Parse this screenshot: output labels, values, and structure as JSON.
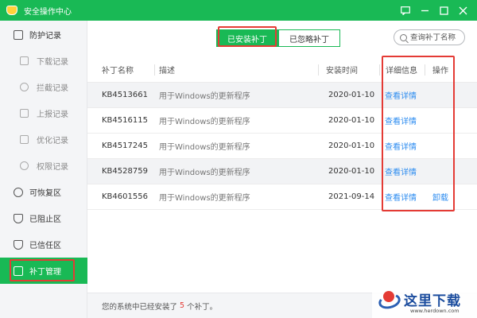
{
  "window": {
    "title": "安全操作中心",
    "controls": [
      "message-icon",
      "minimize-icon",
      "maximize-icon",
      "close-icon"
    ]
  },
  "sidebar": {
    "items": [
      {
        "label": "防护记录",
        "icon": "shield-record-icon",
        "type": "group"
      },
      {
        "label": "下载记录",
        "icon": "download-icon",
        "type": "sub"
      },
      {
        "label": "拦截记录",
        "icon": "block-icon",
        "type": "sub"
      },
      {
        "label": "上报记录",
        "icon": "upload-icon",
        "type": "sub"
      },
      {
        "label": "优化记录",
        "icon": "document-icon",
        "type": "sub"
      },
      {
        "label": "权限记录",
        "icon": "key-icon",
        "type": "sub"
      },
      {
        "label": "可恢复区",
        "icon": "restore-icon",
        "type": "group"
      },
      {
        "label": "已阻止区",
        "icon": "blocked-shield-icon",
        "type": "group"
      },
      {
        "label": "已信任区",
        "icon": "trusted-shield-icon",
        "type": "group"
      },
      {
        "label": "补丁管理",
        "icon": "grid-icon",
        "type": "group",
        "active": true
      }
    ]
  },
  "tabs": [
    {
      "label": "已安装补丁",
      "active": true
    },
    {
      "label": "已忽略补丁",
      "active": false
    }
  ],
  "search": {
    "placeholder": "查询补丁名称"
  },
  "table": {
    "headers": {
      "name": "补丁名称",
      "desc": "描述",
      "date": "安装时间",
      "detail": "详细信息",
      "op": "操作"
    },
    "rows": [
      {
        "name": "KB4513661",
        "desc": "用于Windows的更新程序",
        "date": "2020-01-10",
        "detail": "查看详情",
        "op": ""
      },
      {
        "name": "KB4516115",
        "desc": "用于Windows的更新程序",
        "date": "2020-01-10",
        "detail": "查看详情",
        "op": ""
      },
      {
        "name": "KB4517245",
        "desc": "用于Windows的更新程序",
        "date": "2020-01-10",
        "detail": "查看详情",
        "op": ""
      },
      {
        "name": "KB4528759",
        "desc": "用于Windows的更新程序",
        "date": "2020-01-10",
        "detail": "查看详情",
        "op": ""
      },
      {
        "name": "KB4601556",
        "desc": "用于Windows的更新程序",
        "date": "2021-09-14",
        "detail": "查看详情",
        "op": "卸载"
      }
    ]
  },
  "footer": {
    "prefix": "您的系统中已经安装了",
    "count": "5",
    "suffix": "个补丁。"
  },
  "watermark": {
    "text": "这里下载",
    "url": "www.herdown.com"
  },
  "colors": {
    "brand": "#19b955",
    "highlight": "#e43b35",
    "link": "#2d8cf0"
  }
}
